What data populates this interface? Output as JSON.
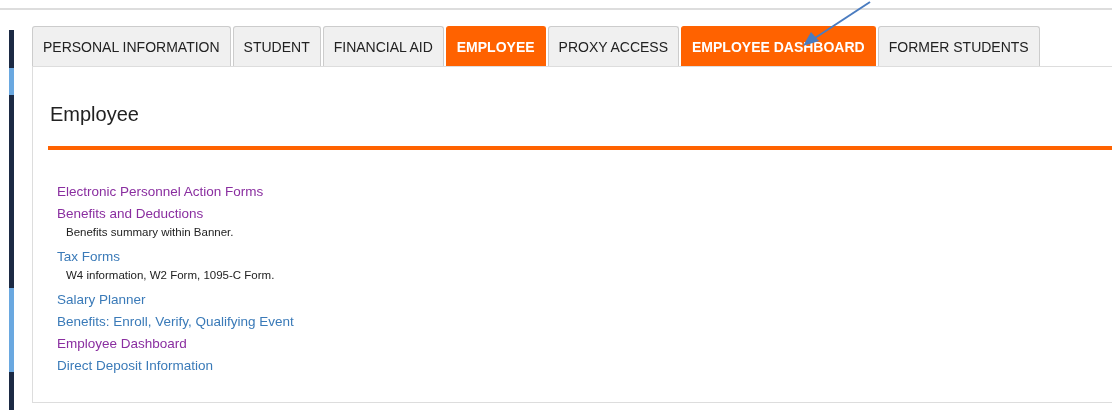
{
  "tabs": [
    {
      "label": "PERSONAL INFORMATION",
      "selected": false
    },
    {
      "label": "STUDENT",
      "selected": false
    },
    {
      "label": "FINANCIAL AID",
      "selected": false
    },
    {
      "label": "EMPLOYEE",
      "selected": true
    },
    {
      "label": "PROXY ACCESS",
      "selected": false
    },
    {
      "label": "EMPLOYEE DASHBOARD",
      "selected": true
    },
    {
      "label": "FORMER STUDENTS",
      "selected": false
    }
  ],
  "panel": {
    "heading": "Employee",
    "links": [
      {
        "label": "Electronic Personnel Action Forms",
        "visited": true
      },
      {
        "label": "Benefits and Deductions",
        "visited": true,
        "description": "Benefits summary within Banner."
      },
      {
        "label": "Tax Forms",
        "visited": false,
        "description": "W4 information, W2 Form, 1095-C Form."
      },
      {
        "label": "Salary Planner",
        "visited": false
      },
      {
        "label": "Benefits: Enroll, Verify, Qualifying Event",
        "visited": false
      },
      {
        "label": "Employee Dashboard",
        "visited": true
      },
      {
        "label": "Direct Deposit Information",
        "visited": false
      }
    ]
  }
}
